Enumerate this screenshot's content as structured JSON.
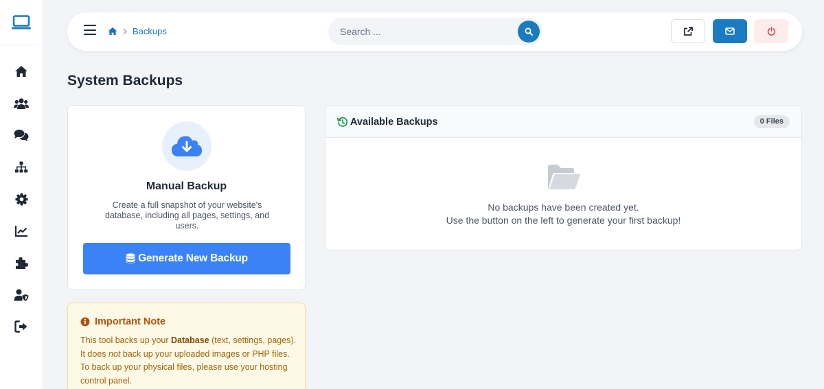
{
  "header": {
    "breadcrumb": "Backups",
    "search": {
      "placeholder": "Search ..."
    }
  },
  "sidebar": {
    "items": [
      {
        "icon": "home-icon"
      },
      {
        "icon": "users-icon"
      },
      {
        "icon": "comments-icon"
      },
      {
        "icon": "sitemap-icon"
      },
      {
        "icon": "gear-icon"
      },
      {
        "icon": "chart-line-icon"
      },
      {
        "icon": "puzzle-icon"
      },
      {
        "icon": "user-shield-icon"
      },
      {
        "icon": "logout-icon"
      }
    ]
  },
  "page": {
    "title": "System Backups"
  },
  "manual_backup": {
    "title": "Manual Backup",
    "description": "Create a full snapshot of your website's database, including all pages, settings, and users.",
    "button_label": "Generate New Backup"
  },
  "note": {
    "title": "Important Note",
    "text_1": "This tool backs up your ",
    "bold_1": "Database",
    "text_2": " (text, settings, pages). It does ",
    "italic_1": "not",
    "text_3": " back up your uploaded images or PHP files. To back up your physical files, please use your hosting control panel."
  },
  "available_backups": {
    "title": "Available Backups",
    "badge": "0 Files",
    "empty_line_1": "No backups have been created yet.",
    "empty_line_2": "Use the button on the left to generate your first backup!"
  },
  "colors": {
    "primary": "#1a7bc2",
    "button": "#3b82f6",
    "danger_bg": "#fdecec",
    "danger": "#e04444",
    "note_bg": "#fef9e6",
    "note_text": "#b45309",
    "history_icon": "#16a34a"
  }
}
